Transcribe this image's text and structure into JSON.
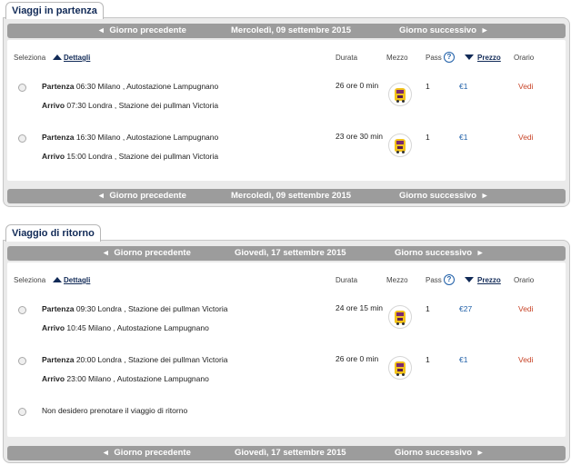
{
  "outbound": {
    "title": "Viaggi in partenza",
    "nav": {
      "prev": "Giorno precedente",
      "date": "Mercoledì, 09 settembre 2015",
      "next": "Giorno successivo"
    },
    "columns": {
      "select": "Seleziona",
      "details": "Dettagli",
      "duration": "Durata",
      "vehicle": "Mezzo",
      "pass": "Pass",
      "price": "Prezzo",
      "timetable": "Orario"
    },
    "rows": [
      {
        "dep_label": "Partenza",
        "dep": "06:30 Milano , Autostazione Lampugnano",
        "arr_label": "Arrivo",
        "arr": "07:30 Londra , Stazione dei pullman Victoria",
        "duration": "26 ore 0 min",
        "pass": "1",
        "price": "€1",
        "action": "Vedi"
      },
      {
        "dep_label": "Partenza",
        "dep": "16:30 Milano , Autostazione Lampugnano",
        "arr_label": "Arrivo",
        "arr": "15:00 Londra , Stazione dei pullman Victoria",
        "duration": "23 ore 30 min",
        "pass": "1",
        "price": "€1",
        "action": "Vedi"
      }
    ]
  },
  "return": {
    "title": "Viaggio di ritorno",
    "nav": {
      "prev": "Giorno precedente",
      "date": "Giovedì, 17 settembre 2015",
      "next": "Giorno successivo"
    },
    "columns": {
      "select": "Seleziona",
      "details": "Dettagli",
      "duration": "Durata",
      "vehicle": "Mezzo",
      "pass": "Pass",
      "price": "Prezzo",
      "timetable": "Orario"
    },
    "rows": [
      {
        "dep_label": "Partenza",
        "dep": "09:30 Londra , Stazione dei pullman Victoria",
        "arr_label": "Arrivo",
        "arr": "10:45 Milano , Autostazione Lampugnano",
        "duration": "24 ore 15 min",
        "pass": "1",
        "price": "€27",
        "action": "Vedi"
      },
      {
        "dep_label": "Partenza",
        "dep": "20:00 Londra , Stazione dei pullman Victoria",
        "arr_label": "Arrivo",
        "arr": "23:00 Milano , Autostazione Lampugnano",
        "duration": "26 ore 0 min",
        "pass": "1",
        "price": "€1",
        "action": "Vedi"
      }
    ],
    "no_return": "Non desidero prenotare il viaggio di ritorno"
  },
  "icons": {
    "prev": "chevron-left-icon",
    "next": "chevron-right-icon",
    "help": "question-circle-icon",
    "vehicle": "bus-icon"
  },
  "glyphs": {
    "prev": "◂",
    "next": "▸",
    "help": "?"
  },
  "colors": {
    "accent": "#112a57",
    "link": "#1f5fa8",
    "vedi": "#c8462a",
    "navbar": "#9c9c9c",
    "bus": "#f2c21b"
  }
}
